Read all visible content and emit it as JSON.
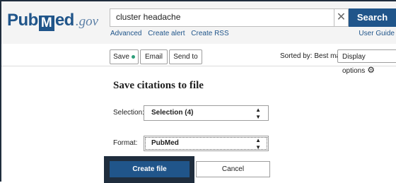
{
  "brand": {
    "pub": "Pub",
    "m": "M",
    "ed": "ed",
    "gov": ".gov"
  },
  "search": {
    "query": "cluster headache",
    "clear_symbol": "✕",
    "button_label": "Search"
  },
  "sublinks": [
    "Advanced",
    "Create alert",
    "Create RSS"
  ],
  "user_guide": "User Guide",
  "toolbar": {
    "save_label": "Save",
    "email_label": "Email",
    "send_to_label": "Send to",
    "sorted_by": "Sorted by: Best match",
    "display_options": "Display options",
    "gear_symbol": "⚙"
  },
  "save_panel": {
    "title": "Save citations to file",
    "selection_label": "Selection:",
    "selection_value": "Selection (4)",
    "format_label": "Format:",
    "format_value": "PubMed",
    "create_label": "Create file",
    "cancel_label": "Cancel"
  },
  "colors": {
    "brand_blue": "#20558a",
    "frame": "#1f2d3d",
    "save_dot": "#2e9e7a"
  }
}
